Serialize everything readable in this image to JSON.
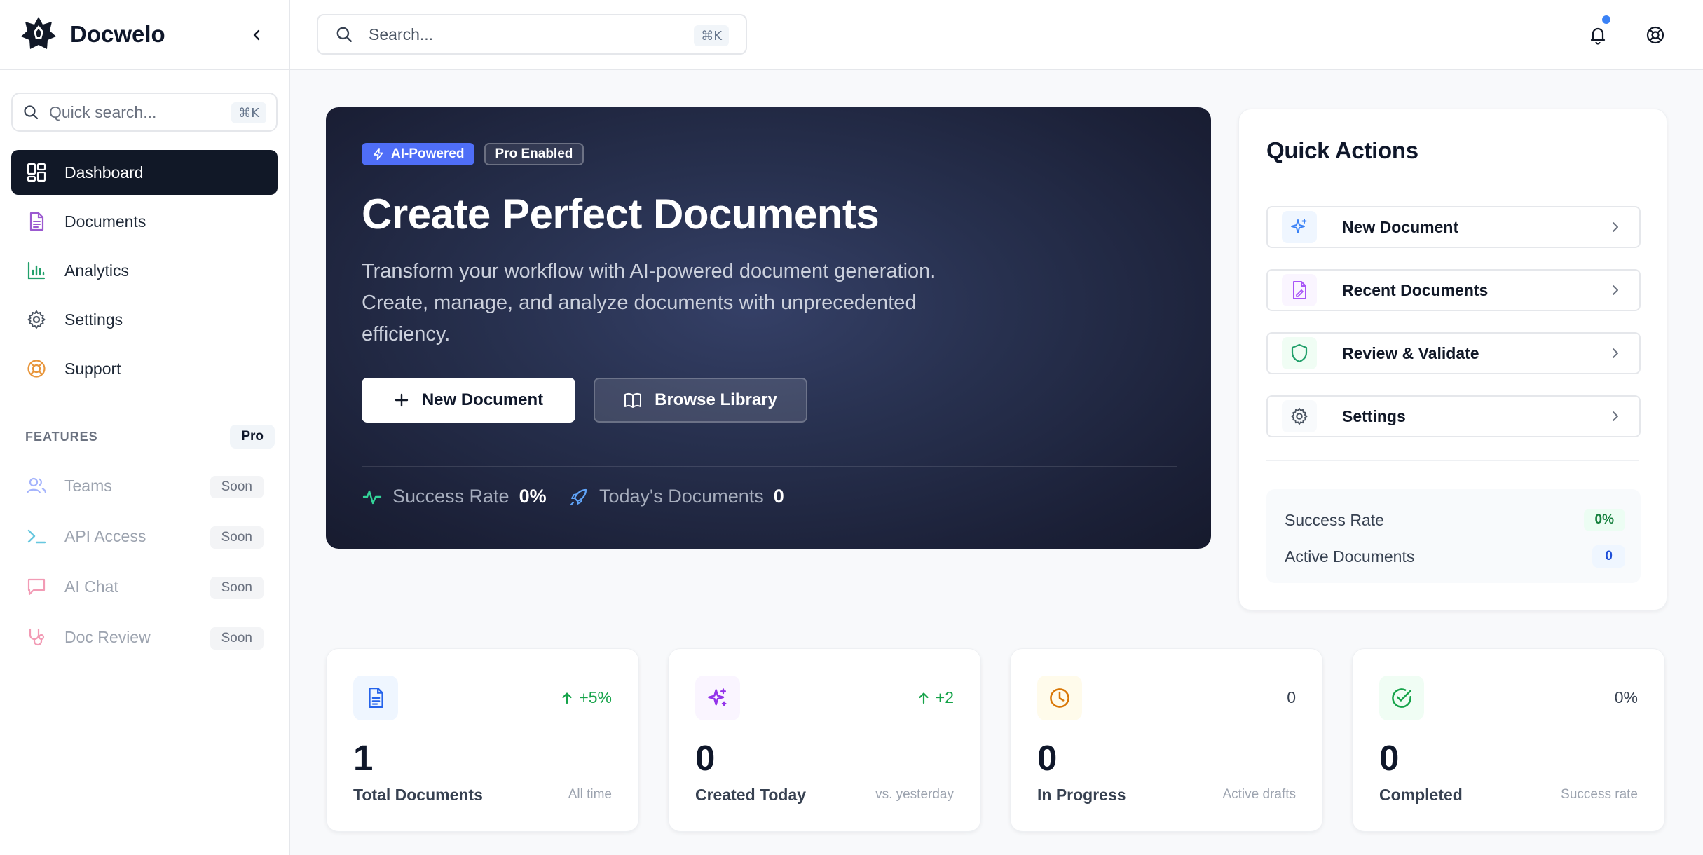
{
  "brand": {
    "name": "Docwelo"
  },
  "sidebar": {
    "quick_search_placeholder": "Quick search...",
    "quick_search_kbd": "⌘K",
    "nav": [
      {
        "label": "Dashboard",
        "icon": "dashboard-icon",
        "active": true
      },
      {
        "label": "Documents",
        "icon": "document-icon"
      },
      {
        "label": "Analytics",
        "icon": "bar-chart-icon"
      },
      {
        "label": "Settings",
        "icon": "gear-icon"
      },
      {
        "label": "Support",
        "icon": "lifebuoy-icon"
      }
    ],
    "features_title": "FEATURES",
    "features_badge": "Pro",
    "features": [
      {
        "label": "Teams",
        "icon": "users-icon",
        "badge": "Soon"
      },
      {
        "label": "API Access",
        "icon": "terminal-icon",
        "badge": "Soon"
      },
      {
        "label": "AI Chat",
        "icon": "chat-icon",
        "badge": "Soon"
      },
      {
        "label": "Doc Review",
        "icon": "stethoscope-icon",
        "badge": "Soon"
      }
    ]
  },
  "topbar": {
    "search_placeholder": "Search...",
    "search_kbd": "⌘K"
  },
  "hero": {
    "badge_ai": "AI-Powered",
    "badge_pro": "Pro Enabled",
    "title": "Create Perfect Documents",
    "subtitle": "Transform your workflow with AI-powered document generation. Create, manage, and analyze documents with unprecedented efficiency.",
    "primary_button": "New Document",
    "secondary_button": "Browse Library",
    "stats": [
      {
        "label": "Success Rate",
        "value": "0%"
      },
      {
        "label": "Today's Documents",
        "value": "0"
      }
    ]
  },
  "quick_actions": {
    "title": "Quick Actions",
    "items": [
      {
        "label": "New Document",
        "icon": "sparkles-icon"
      },
      {
        "label": "Recent Documents",
        "icon": "file-signature-icon"
      },
      {
        "label": "Review & Validate",
        "icon": "shield-icon"
      },
      {
        "label": "Settings",
        "icon": "gear-icon"
      }
    ],
    "stats": [
      {
        "label": "Success Rate",
        "value": "0%"
      },
      {
        "label": "Active Documents",
        "value": "0"
      }
    ]
  },
  "stat_cards": [
    {
      "value": "1",
      "label": "Total Documents",
      "sub": "All time",
      "trend": "+5%",
      "icon": "document-icon"
    },
    {
      "value": "0",
      "label": "Created Today",
      "sub": "vs. yesterday",
      "trend": "+2",
      "icon": "sparkles-icon"
    },
    {
      "value": "0",
      "label": "In Progress",
      "sub": "Active drafts",
      "trend": "0",
      "icon": "clock-icon"
    },
    {
      "value": "0",
      "label": "Completed",
      "sub": "Success rate",
      "trend": "0%",
      "icon": "check-circle-icon"
    }
  ],
  "colors": {
    "accent_blue": "#4f6ef7",
    "hero_bg": "#1f2540",
    "active_nav_bg": "#111827",
    "trend_green": "#16a34a"
  }
}
